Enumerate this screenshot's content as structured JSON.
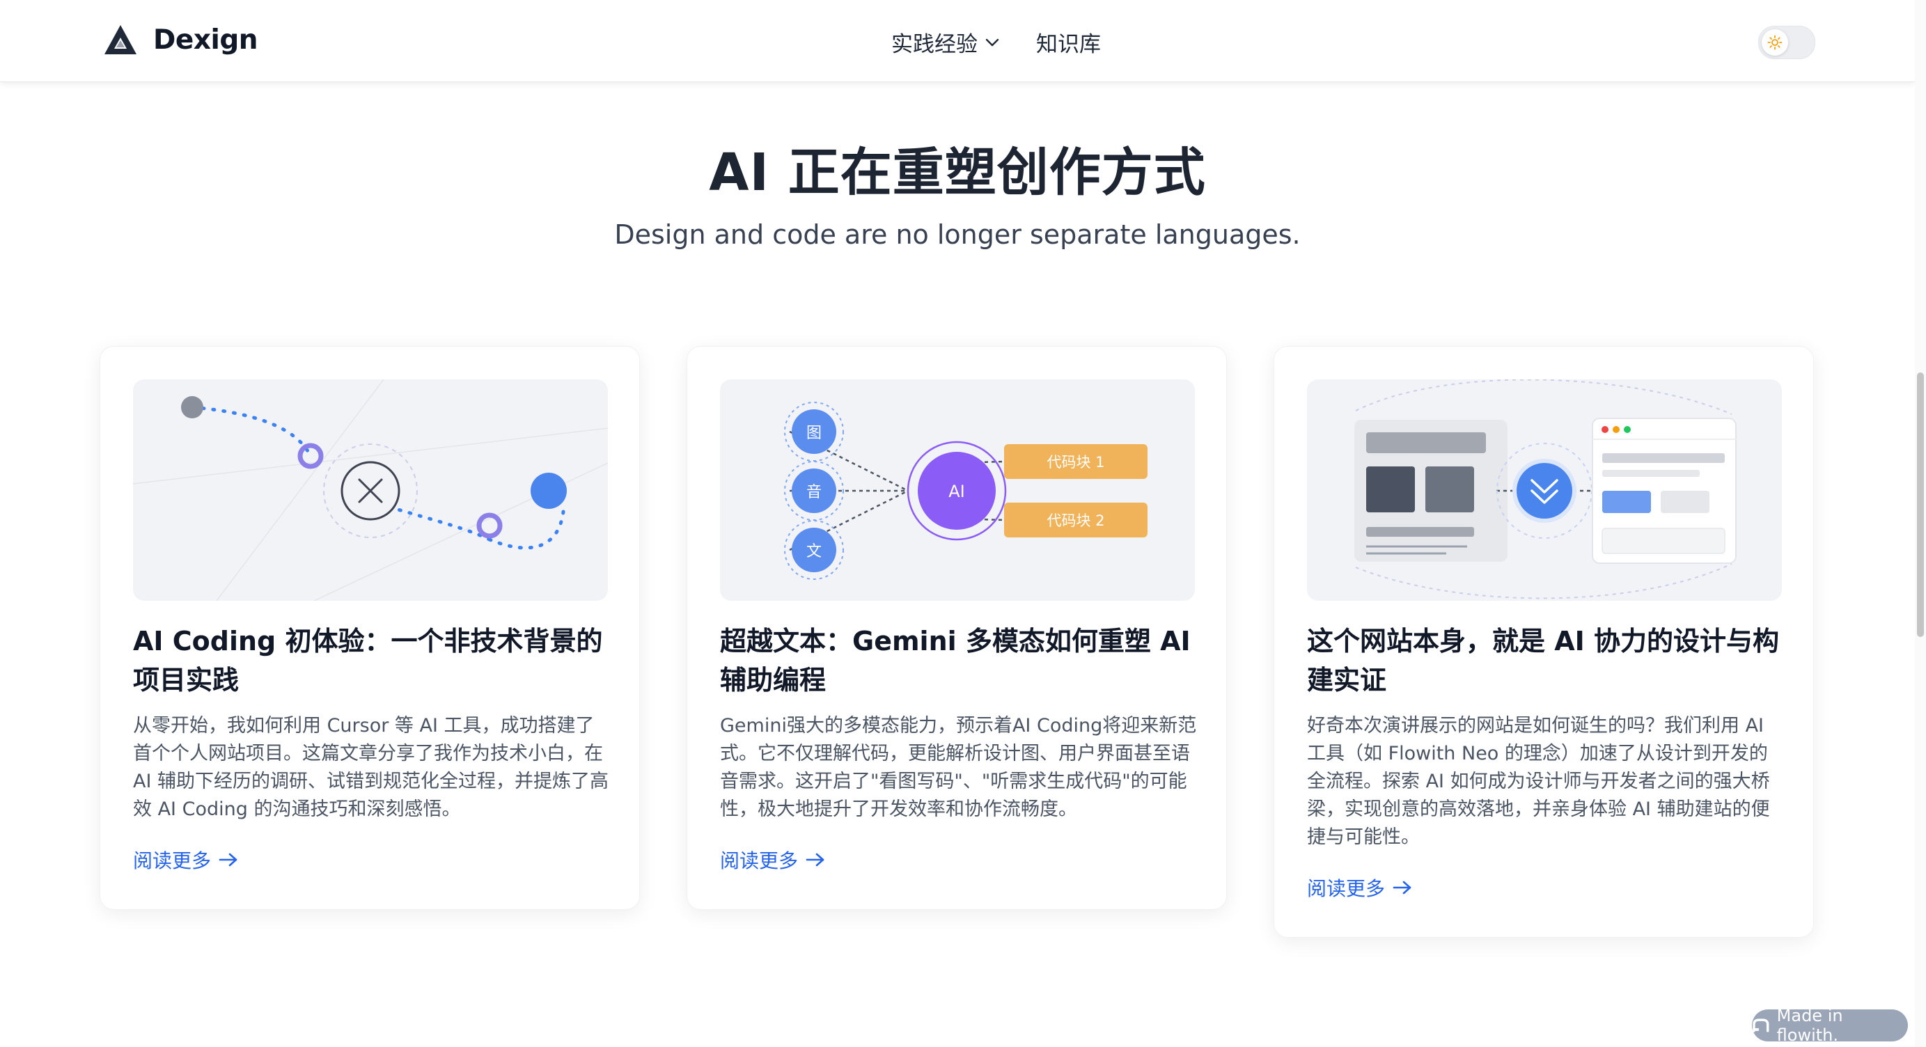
{
  "header": {
    "brand": "Dexign",
    "nav": [
      {
        "label": "实践经验",
        "has_dropdown": true
      },
      {
        "label": "知识库",
        "has_dropdown": false
      }
    ],
    "theme_toggle_icon": "sun-icon"
  },
  "hero": {
    "title": "AI 正在重塑创作方式",
    "subtitle": "Design and code are no longer separate languages."
  },
  "cards": [
    {
      "title": "AI Coding 初体验：一个非技术背景的项目实践",
      "desc": "从零开始，我如何利用 Cursor 等 AI 工具，成功搭建了首个个人网站项目。这篇文章分享了我作为技术小白，在 AI 辅助下经历的调研、试错到规范化全过程，并提炼了高效 AI Coding 的沟通技巧和深刻感悟。",
      "link": "阅读更多"
    },
    {
      "title": "超越文本：Gemini 多模态如何重塑 AI 辅助编程",
      "desc": "Gemini强大的多模态能力，预示着AI Coding将迎来新范式。它不仅理解代码，更能解析设计图、用户界面甚至语音需求。这开启了\"看图写码\"、\"听需求生成代码\"的可能性，极大地提升了开发效率和协作流畅度。",
      "link": "阅读更多",
      "diagram": {
        "inputs": [
          "图",
          "音",
          "文"
        ],
        "center": "AI",
        "outputs": [
          "代码块 1",
          "代码块 2"
        ]
      }
    },
    {
      "title": "这个网站本身，就是 AI 协力的设计与构建实证",
      "desc": "好奇本次演讲展示的网站是如何诞生的吗？我们利用 AI 工具（如 Flowith Neo 的理念）加速了从设计到开发的全流程。探索 AI 如何成为设计师与开发者之间的强大桥梁，实现创意的高效落地，并亲身体验 AI 辅助建站的便捷与可能性。",
      "link": "阅读更多"
    }
  ],
  "badge": {
    "label": "Made in flowith."
  },
  "colors": {
    "accent": "#2563eb",
    "ai_purple": "#8b5cf6",
    "input_blue": "#5b8def",
    "code_orange": "#f0b35a"
  }
}
